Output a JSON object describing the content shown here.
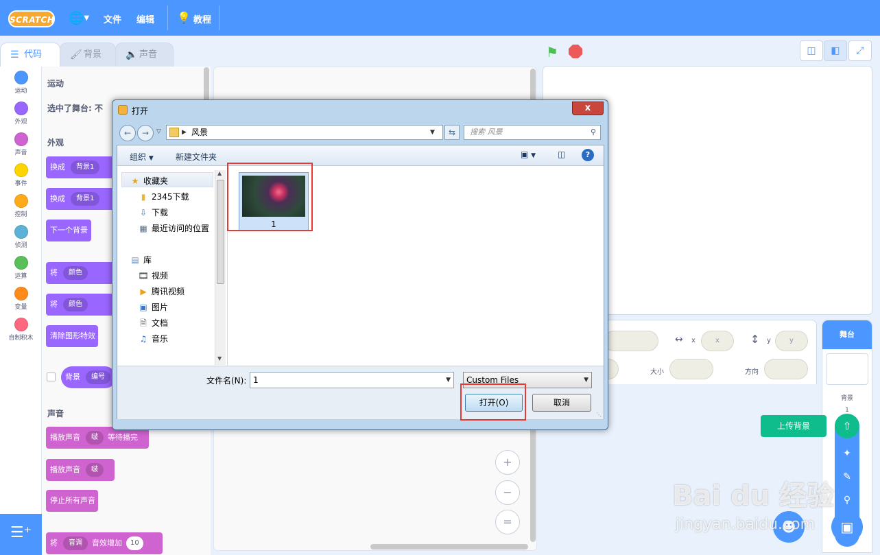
{
  "menubar": {
    "logo": "SCRATCH",
    "file": "文件",
    "edit": "编辑",
    "tutorials": "教程",
    "globe_icon": "globe-icon",
    "color": "#4c97ff"
  },
  "tabs": {
    "code": "代码",
    "backdrops": "背景",
    "sounds": "声音"
  },
  "categories": [
    {
      "label": "运动",
      "color": "#4c97ff"
    },
    {
      "label": "外观",
      "color": "#9966ff"
    },
    {
      "label": "声音",
      "color": "#cf63cf"
    },
    {
      "label": "事件",
      "color": "#ffd500"
    },
    {
      "label": "控制",
      "color": "#ffab19"
    },
    {
      "label": "侦测",
      "color": "#5cb1d6"
    },
    {
      "label": "运算",
      "color": "#59c059"
    },
    {
      "label": "变量",
      "color": "#ff8c1a"
    },
    {
      "label": "自制积木",
      "color": "#ff6680"
    }
  ],
  "palette": {
    "motion_title": "运动",
    "motion_note": "选中了舞台: 不",
    "looks_title": "外观",
    "sound_title": "声音",
    "looks_blocks": {
      "switch1": "换成",
      "switch1_arg": "背景1",
      "switch2": "换成",
      "switch2_arg": "背景1",
      "next": "下一个背景",
      "set1": "将",
      "set1_arg": "颜色",
      "set2": "将",
      "set2_arg": "颜色",
      "clear": "清除图形特效",
      "backdrop_reporter": "背景",
      "backdrop_reporter_arg": "编号"
    },
    "sound_blocks": {
      "play_until": "播放声音",
      "play_until_arg": "啵",
      "play_until_tail": "等待播完",
      "play": "播放声音",
      "play_arg": "啵",
      "stop": "停止所有声音",
      "change": "将",
      "change_arg": "音调",
      "change_tail": "音效增加",
      "change_num": "10"
    }
  },
  "zoom": {
    "in": "+",
    "out": "−",
    "reset": "="
  },
  "sprite_info": {
    "x_label": "x",
    "x_placeholder": "x",
    "y_label": "y",
    "y_placeholder": "y",
    "size_label": "大小",
    "direction_label": "方向"
  },
  "stage_col": {
    "title": "舞台",
    "backdrops_label": "背景",
    "backdrops_count": "1"
  },
  "backdrop_menu": {
    "tooltip": "上传背景"
  },
  "watermark": {
    "main": "Bai du 经验",
    "sub": "jingyan.baidu.com"
  },
  "dialog": {
    "title": "打开",
    "close": "x",
    "path": "风景",
    "search_placeholder": "搜索 风景",
    "organize": "组织",
    "new_folder": "新建文件夹",
    "help": "?",
    "nav": {
      "favorites": "收藏夹",
      "downloads_2345": "2345下载",
      "downloads": "下载",
      "recent": "最近访问的位置",
      "libraries": "库",
      "videos": "视频",
      "tencent_video": "腾讯视频",
      "pictures": "图片",
      "documents": "文档",
      "music": "音乐"
    },
    "file": {
      "name": "1"
    },
    "filename_label": "文件名(N):",
    "filename_value": "1",
    "filetype": "Custom Files",
    "open": "打开(O)",
    "cancel": "取消"
  }
}
